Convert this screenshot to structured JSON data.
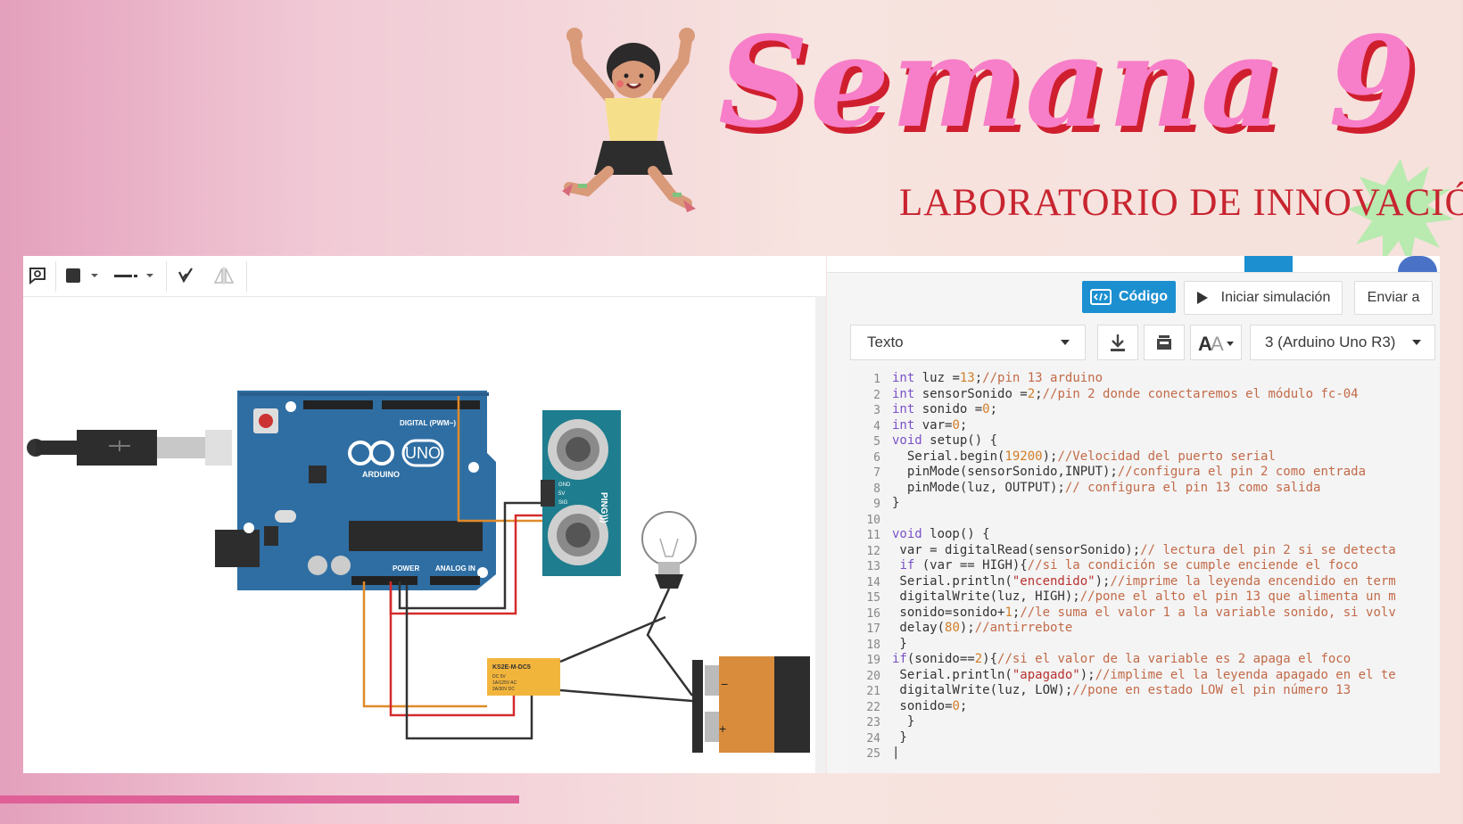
{
  "header": {
    "title": "Semana 9",
    "subtitle": "LABORATORIO DE INNOVACIÓN"
  },
  "colors": {
    "title_pink": "#f77ec8",
    "title_shadow": "#cf1f2e",
    "accent_blue": "#1b8fd0",
    "bottom_bar": "#df5f97"
  },
  "circuit": {
    "toolbar_icons": [
      "note-icon",
      "fill-color-icon",
      "line-style-icon",
      "flip-icon",
      "mirror-icon"
    ],
    "components": {
      "arduino": {
        "brand": "ARDUINO",
        "model": "UNO",
        "digital_label": "DIGITAL (PWM~)",
        "power_label": "POWER",
        "analog_label": "ANALOG IN"
      },
      "sensor": {
        "name": "PING)))",
        "pins": [
          "GND",
          "5V",
          "SIG"
        ]
      },
      "relay": {
        "model": "KS2E-M-DC5",
        "specs": [
          "DC 5V",
          "1A/125V AC",
          "2A/30V DC"
        ]
      }
    }
  },
  "code_panel": {
    "buttons": {
      "codigo": "Código",
      "simulate": "Iniciar simulación",
      "send": "Enviar a"
    },
    "mode_select": "Texto",
    "device_select": "3 (Arduino Uno R3)",
    "icons": [
      "download-icon",
      "library-icon",
      "font-size-icon"
    ],
    "lines": [
      [
        {
          "t": "int",
          "c": "kw"
        },
        {
          "t": " luz ="
        },
        {
          "t": "13",
          "c": "num"
        },
        {
          "t": ";"
        },
        {
          "t": "//pin 13 arduino",
          "c": "cm"
        }
      ],
      [
        {
          "t": "int",
          "c": "kw"
        },
        {
          "t": " sensorSonido ="
        },
        {
          "t": "2",
          "c": "num"
        },
        {
          "t": ";"
        },
        {
          "t": "//pin 2 donde conectaremos el módulo fc-04",
          "c": "cm"
        }
      ],
      [
        {
          "t": "int",
          "c": "kw"
        },
        {
          "t": " sonido ="
        },
        {
          "t": "0",
          "c": "num"
        },
        {
          "t": ";"
        }
      ],
      [
        {
          "t": "int",
          "c": "kw"
        },
        {
          "t": " var="
        },
        {
          "t": "0",
          "c": "num"
        },
        {
          "t": ";"
        }
      ],
      [
        {
          "t": "void",
          "c": "kw"
        },
        {
          "t": " setup() {"
        }
      ],
      [
        {
          "t": "  Serial.begin("
        },
        {
          "t": "19200",
          "c": "num"
        },
        {
          "t": ");"
        },
        {
          "t": "//Velocidad del puerto serial",
          "c": "cm"
        }
      ],
      [
        {
          "t": "  pinMode(sensorSonido,INPUT);"
        },
        {
          "t": "//configura el pin 2 como entrada",
          "c": "cm"
        }
      ],
      [
        {
          "t": "  pinMode(luz, OUTPUT);"
        },
        {
          "t": "// configura el pin 13 como salida",
          "c": "cm"
        }
      ],
      [
        {
          "t": "}"
        }
      ],
      [],
      [
        {
          "t": "void",
          "c": "kw"
        },
        {
          "t": " loop() {"
        }
      ],
      [
        {
          "t": " var = digitalRead(sensorSonido);"
        },
        {
          "t": "// lectura del pin 2 si se detecta",
          "c": "cm"
        }
      ],
      [
        {
          "t": " "
        },
        {
          "t": "if",
          "c": "kw"
        },
        {
          "t": " (var == HIGH){"
        },
        {
          "t": "//si la condición se cumple enciende el foco",
          "c": "cm"
        }
      ],
      [
        {
          "t": " Serial.println("
        },
        {
          "t": "\"encendido\"",
          "c": "str"
        },
        {
          "t": ");"
        },
        {
          "t": "//imprime la leyenda encendido en term",
          "c": "cm"
        }
      ],
      [
        {
          "t": " digitalWrite(luz, HIGH);"
        },
        {
          "t": "//pone el alto el pin 13 que alimenta un m",
          "c": "cm"
        }
      ],
      [
        {
          "t": " sonido=sonido+"
        },
        {
          "t": "1",
          "c": "num"
        },
        {
          "t": ";"
        },
        {
          "t": "//le suma el valor 1 a la variable sonido, si volv",
          "c": "cm"
        }
      ],
      [
        {
          "t": " delay("
        },
        {
          "t": "80",
          "c": "num"
        },
        {
          "t": ");"
        },
        {
          "t": "//antirrebote",
          "c": "cm"
        }
      ],
      [
        {
          "t": " }"
        }
      ],
      [
        {
          "t": "if",
          "c": "kw"
        },
        {
          "t": "(sonido=="
        },
        {
          "t": "2",
          "c": "num"
        },
        {
          "t": "){"
        },
        {
          "t": "//si el valor de la variable es 2 apaga el foco",
          "c": "cm"
        }
      ],
      [
        {
          "t": " Serial.println("
        },
        {
          "t": "\"apagado\"",
          "c": "str"
        },
        {
          "t": ");"
        },
        {
          "t": "//implime el la leyenda apagado en el te",
          "c": "cm"
        }
      ],
      [
        {
          "t": " digitalWrite(luz, LOW);"
        },
        {
          "t": "//pone en estado LOW el pin número 13",
          "c": "cm"
        }
      ],
      [
        {
          "t": " sonido="
        },
        {
          "t": "0",
          "c": "num"
        },
        {
          "t": ";"
        }
      ],
      [
        {
          "t": "  }"
        }
      ],
      [
        {
          "t": " }"
        }
      ],
      [
        {
          "t": "|"
        }
      ]
    ]
  }
}
